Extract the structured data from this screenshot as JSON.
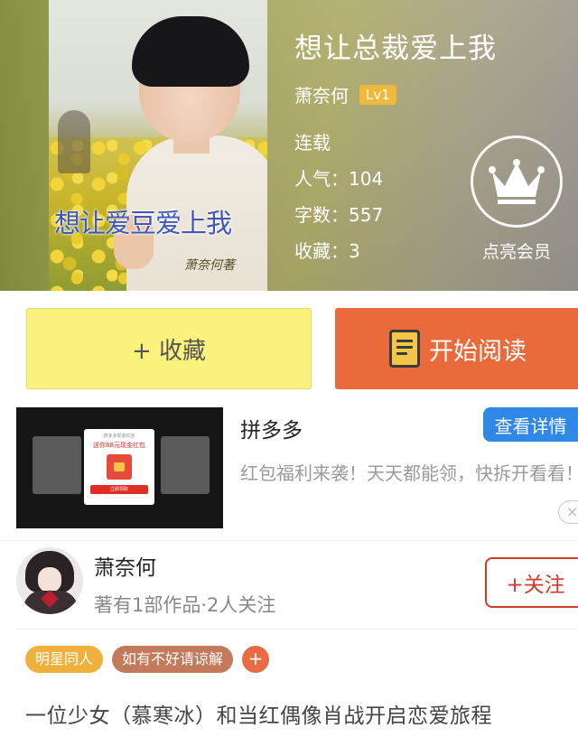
{
  "book": {
    "title": "想让总裁爱上我",
    "author": "萧奈何",
    "level": "Lv1",
    "status": "连载",
    "popularity": "人气：104",
    "word_count": "字数：557",
    "favorites": "收藏：3",
    "cover_title": "想让爱豆爱上我",
    "cover_author": "萧奈何著"
  },
  "vip": {
    "label": "点亮会员",
    "icon": "crown-icon"
  },
  "actions": {
    "collect": "+ 收藏",
    "read": "开始阅读"
  },
  "ad": {
    "title": "拼多多",
    "detail_button": "查看详情",
    "description": "红包福利来袭！天天都能领，快拆开看看！",
    "close": "×",
    "thumb_popup_top": "拼多多现金红包",
    "thumb_popup_offer": "送你88元现金红包",
    "thumb_popup_button": "立即领取"
  },
  "author_section": {
    "name": "萧奈何",
    "stats": "著有1部作品·2人关注",
    "follow_button": "+关注"
  },
  "tags": [
    {
      "label": "明星同人",
      "color": "#f0b13c"
    },
    {
      "label": "如有不好请谅解",
      "color": "#c27a5a"
    }
  ],
  "tag_add": "+",
  "synopsis": "一位少女（慕寒冰）和当红偶像肖战开启恋爱旅程",
  "colors": {
    "collect_bg": "#fbf27d",
    "read_bg": "#ea6a3c",
    "detail_bg": "#2f87e6",
    "follow": "#d23a2a",
    "level_badge": "#f0b93c"
  }
}
